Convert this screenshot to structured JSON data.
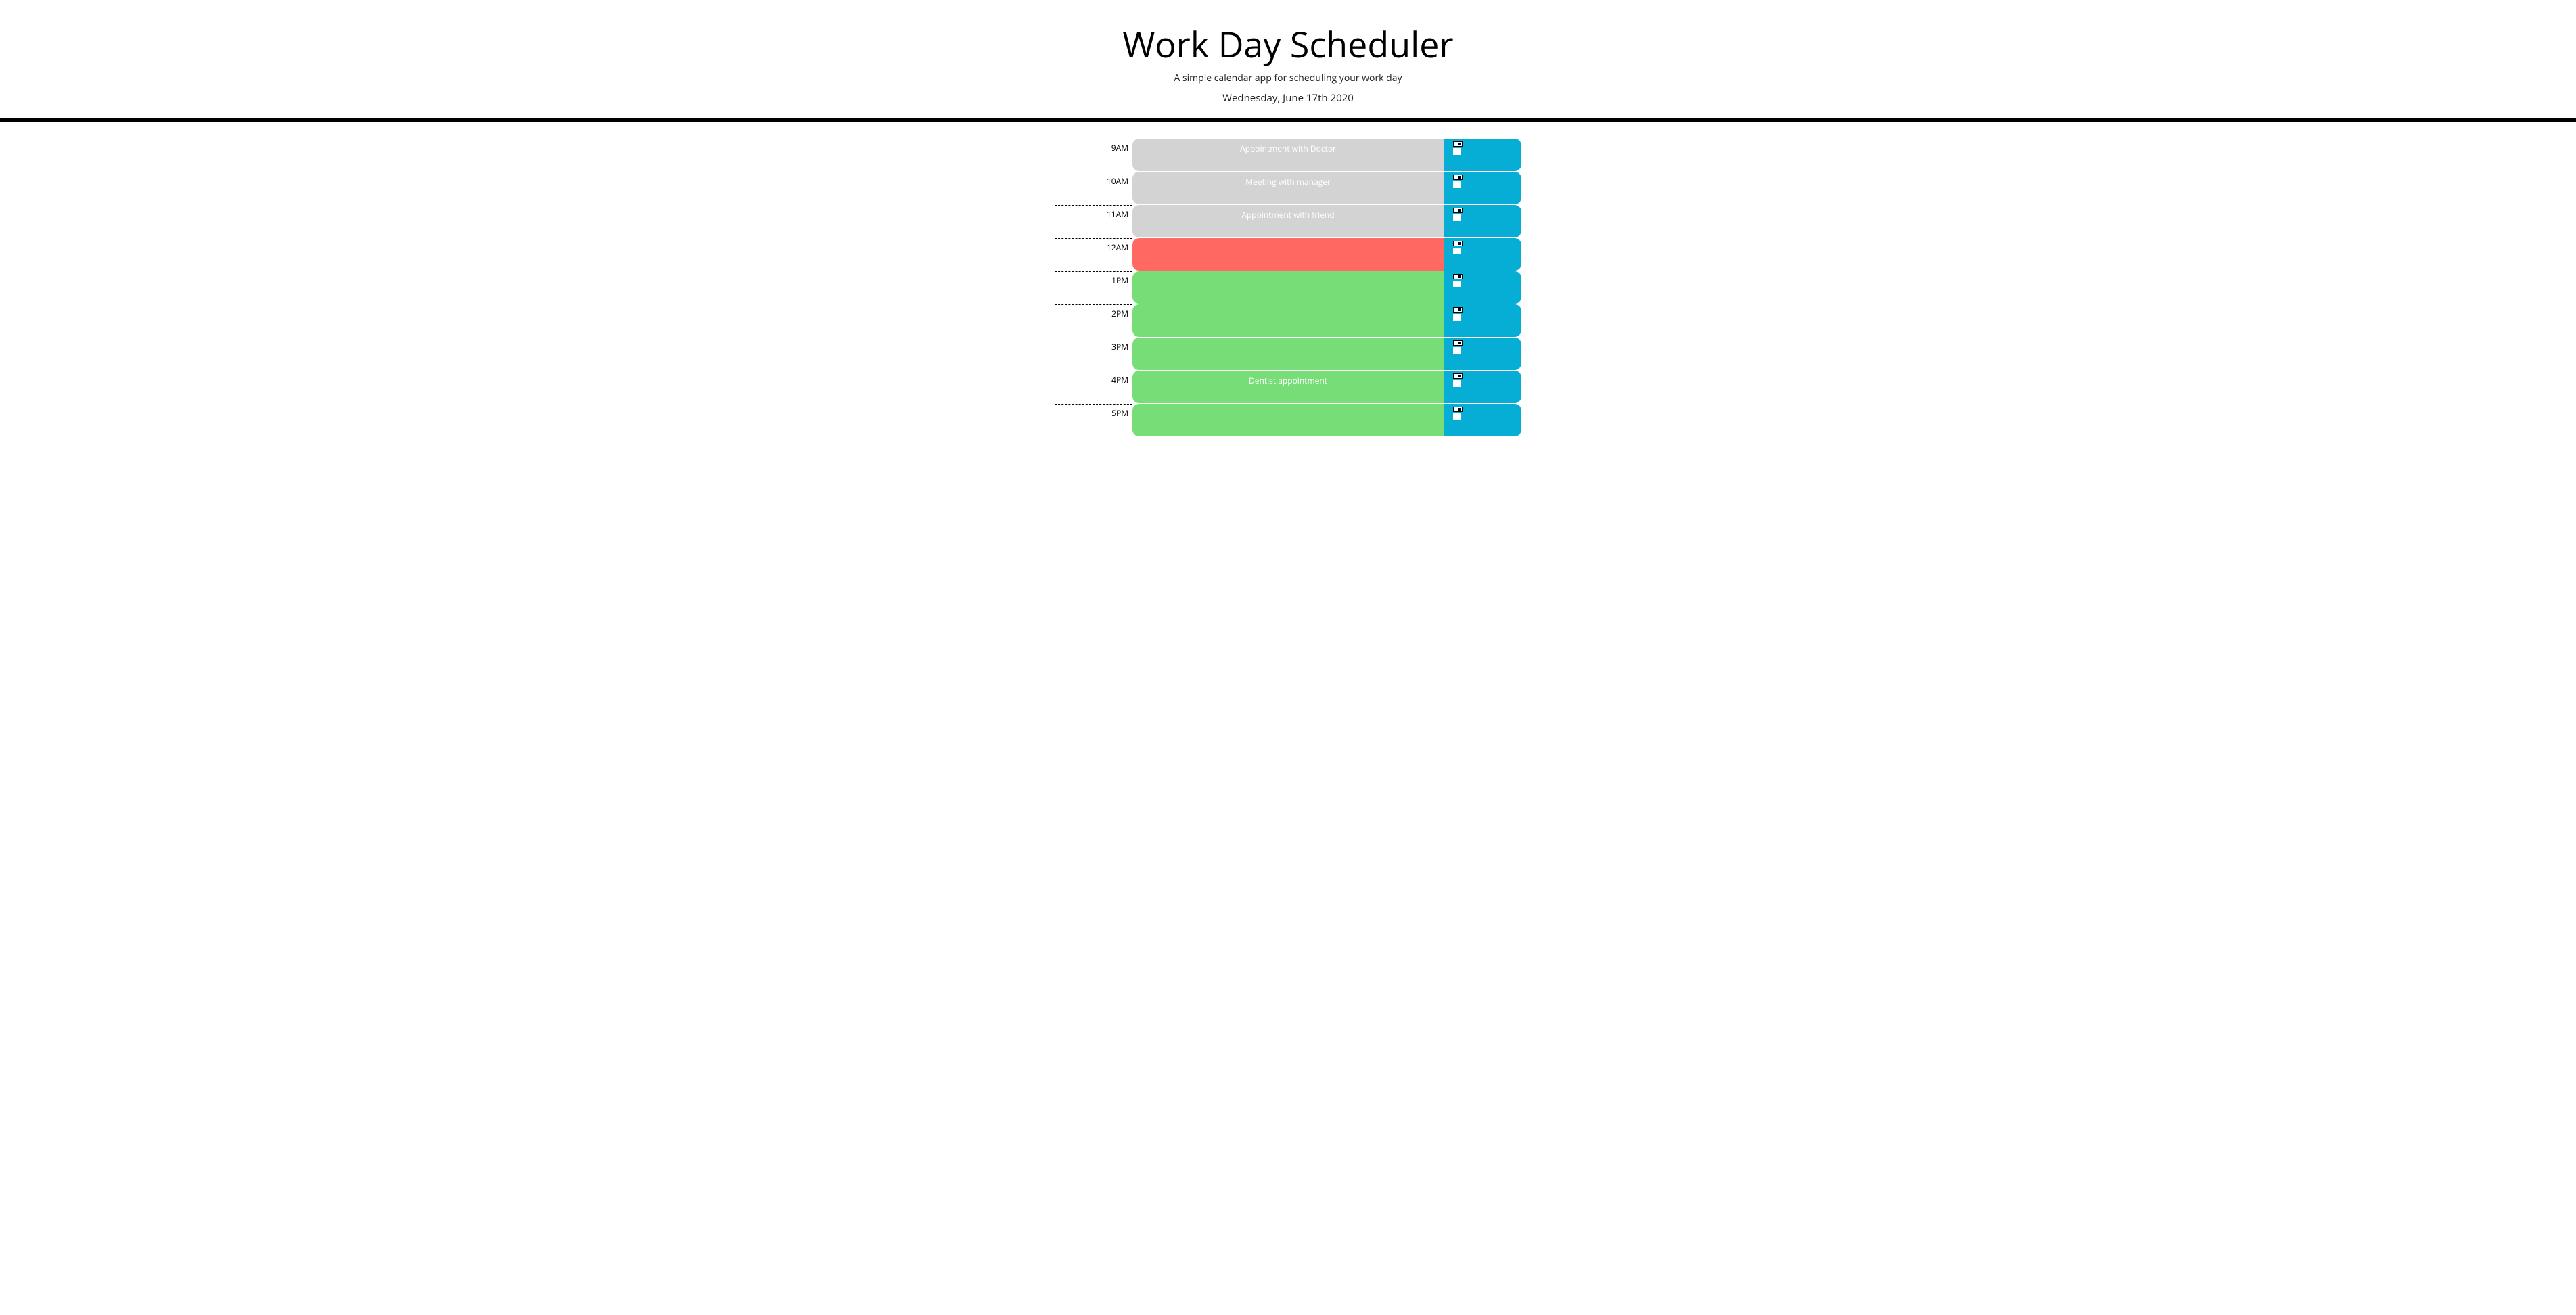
{
  "header": {
    "title": "Work Day Scheduler",
    "subtitle": "A simple calendar app for scheduling your work day",
    "date": "Wednesday, June 17th 2020"
  },
  "colors": {
    "past": "#d3d3d3",
    "present": "#ff6961",
    "future": "#77dd77",
    "saveBtn": "#06aed5"
  },
  "timeBlocks": [
    {
      "hour": "9AM",
      "value": "Appointment with Doctor",
      "status": "past"
    },
    {
      "hour": "10AM",
      "value": "Meeting with manager",
      "status": "past"
    },
    {
      "hour": "11AM",
      "value": "Appointment with friend",
      "status": "past"
    },
    {
      "hour": "12AM",
      "value": "",
      "status": "present"
    },
    {
      "hour": "1PM",
      "value": "",
      "status": "future"
    },
    {
      "hour": "2PM",
      "value": "",
      "status": "future"
    },
    {
      "hour": "3PM",
      "value": "",
      "status": "future"
    },
    {
      "hour": "4PM",
      "value": "Dentist appointment",
      "status": "future"
    },
    {
      "hour": "5PM",
      "value": "",
      "status": "future"
    }
  ]
}
